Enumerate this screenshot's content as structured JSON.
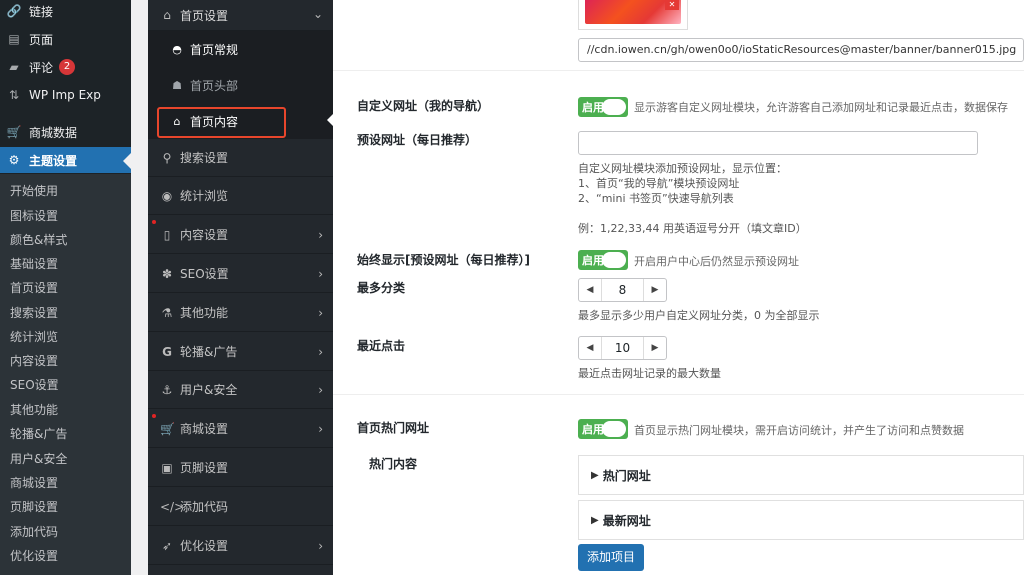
{
  "wp_menu": {
    "items": [
      {
        "label": "链接",
        "icon": "link-icon"
      },
      {
        "label": "页面",
        "icon": "page-icon"
      },
      {
        "label": "评论",
        "icon": "comment-icon",
        "badge": "2"
      },
      {
        "label": "WP Imp Exp",
        "icon": "import-export-icon"
      },
      {
        "label": "商城数据",
        "icon": "cart-icon"
      },
      {
        "label": "主题设置",
        "icon": "gear-icon"
      }
    ],
    "submenu": [
      "开始使用",
      "图标设置",
      "颜色&样式",
      "基础设置",
      "首页设置",
      "搜索设置",
      "统计浏览",
      "内容设置",
      "SEO设置",
      "其他功能",
      "轮播&广告",
      "用户&安全",
      "商城设置",
      "页脚设置",
      "添加代码",
      "优化设置"
    ]
  },
  "io_nav": {
    "home_settings": "首页设置",
    "home_sub": [
      "首页常规",
      "首页头部",
      "首页内容"
    ],
    "items": [
      "搜索设置",
      "统计浏览",
      "内容设置",
      "SEO设置",
      "其他功能",
      "轮播&广告",
      "用户&安全",
      "商城设置",
      "页脚设置",
      "添加代码",
      "优化设置"
    ]
  },
  "content": {
    "banner_url": "//cdn.iowen.cn/gh/owen0o0/ioStaticResources@master/banner/banner015.jpg",
    "custom_url": {
      "label": "自定义网址（我的导航）",
      "toggle": "启用",
      "desc": "显示游客自定义网址模块，允许游客自己添加网址和记录最近点击，数据保存"
    },
    "preset_url": {
      "label": "预设网址（每日推荐）",
      "value": "",
      "desc_1": "自定义网址模块添加预设网址，显示位置：",
      "desc_2": "1、首页“我的导航”模块预设网址",
      "desc_3": "2、“mini 书签页”快速导航列表",
      "desc_4": "例：1,22,33,44 用英语逗号分开（填文章ID）"
    },
    "always_show": {
      "label": "始终显示[预设网址（每日推荐）]",
      "toggle": "启用",
      "desc": "开启用户中心后仍然显示预设网址"
    },
    "max_category": {
      "label": "最多分类",
      "value": "8",
      "desc": "最多显示多少用户自定义网址分类，0 为全部显示"
    },
    "recent_clicks": {
      "label": "最近点击",
      "value": "10",
      "desc": "最近点击网址记录的最大数量"
    },
    "hot_urls": {
      "label": "首页热门网址",
      "toggle": "启用",
      "desc": "首页显示热门网址模块，需开启访问统计，并产生了访问和点赞数据",
      "sub_label": "热门内容",
      "panels": [
        "热门网址",
        "最新网址"
      ],
      "add_button": "添加项目"
    }
  }
}
